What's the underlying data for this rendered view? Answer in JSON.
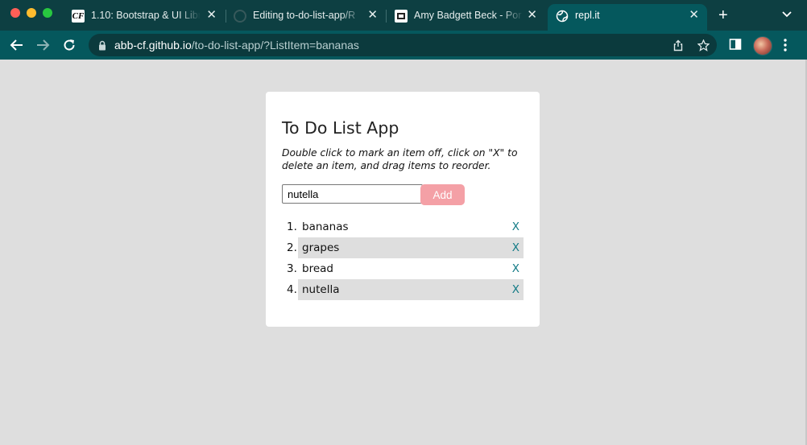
{
  "browser": {
    "tabs": [
      {
        "title": "1.10: Bootstrap & UI Libr",
        "favicon": "careerfoundry-icon"
      },
      {
        "title": "Editing to-do-list-app/R",
        "favicon": "github-icon"
      },
      {
        "title": "Amy Badgett Beck - Por",
        "favicon": "portfolio-icon"
      },
      {
        "title": "repl.it",
        "favicon": "globe-icon"
      }
    ],
    "close_glyph": "✕",
    "new_tab_glyph": "+",
    "url_host": "abb-cf.github.io",
    "url_path": "/to-do-list-app/?ListItem=bananas"
  },
  "app": {
    "title": "To Do List App",
    "instructions": "Double click to mark an item off, click on \"X\" to delete an item, and drag items to reorder.",
    "input_value": "nutella",
    "add_label": "Add",
    "items": [
      {
        "number": "1.",
        "text": "bananas",
        "delete": "X",
        "shaded": false
      },
      {
        "number": "2.",
        "text": "grapes",
        "delete": "X",
        "shaded": true
      },
      {
        "number": "3.",
        "text": "bread",
        "delete": "X",
        "shaded": false
      },
      {
        "number": "4.",
        "text": "nutella",
        "delete": "X",
        "shaded": true
      }
    ]
  },
  "colors": {
    "chrome_dark": "#0d3f42",
    "chrome_toolbar": "#05585d",
    "page_bg": "#dedede",
    "add_button": "#f4a0a6",
    "delete_link": "#137b86"
  }
}
